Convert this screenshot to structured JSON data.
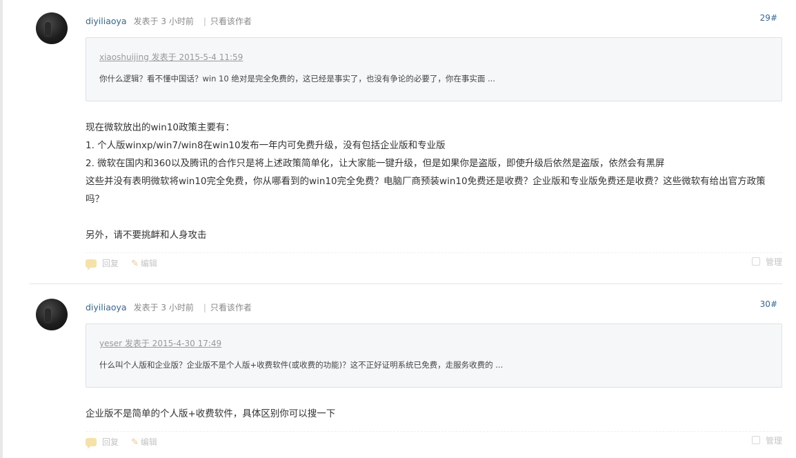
{
  "posts": [
    {
      "author": "diyiliaoya",
      "time": "发表于 3 小时前",
      "separator": "|",
      "only_author": "只看该作者",
      "floor": "29#",
      "quote": {
        "head": "xiaoshuijing 发表于 2015-5-4 11:59",
        "text": "你什么逻辑？看不懂中国话？win 10 绝对是完全免费的，这已经是事实了，也没有争论的必要了，你在事实面 ..."
      },
      "body": [
        "现在微软放出的win10政策主要有：",
        "1. 个人版winxp/win7/win8在win10发布一年内可免费升级，没有包括企业版和专业版",
        "2. 微软在国内和360以及腾讯的合作只是将上述政策简单化，让大家能一键升级，但是如果你是盗版，即使升级后依然是盗版，依然会有黑屏",
        "这些并没有表明微软将win10完全免费，你从哪看到的win10完全免费？电脑厂商预装win10免费还是收费？企业版和专业版免费还是收费？这些微软有给出官方政策吗？",
        "",
        "另外，请不要挑衅和人身攻击"
      ],
      "actions": {
        "reply": "回复",
        "edit": "编辑",
        "manage": "管理"
      }
    },
    {
      "author": "diyiliaoya",
      "time": "发表于 3 小时前",
      "separator": "|",
      "only_author": "只看该作者",
      "floor": "30#",
      "quote": {
        "head": "yeser 发表于 2015-4-30 17:49",
        "text": "什么叫个人版和企业版？企业版不是个人版+收费软件(或收费的功能)？这不正好证明系统已免费，走服务收费的 ..."
      },
      "body": [
        "企业版不是简单的个人版+收费软件，具体区别你可以搜一下"
      ],
      "actions": {
        "reply": "回复",
        "edit": "编辑",
        "manage": "管理"
      }
    }
  ]
}
